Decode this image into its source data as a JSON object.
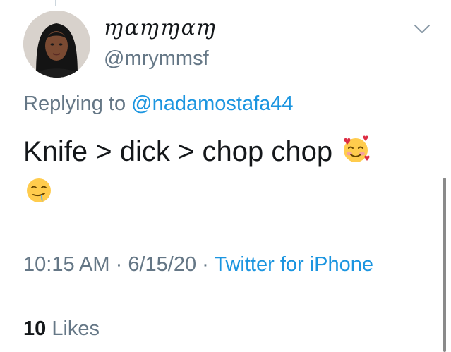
{
  "tweet": {
    "display_name": "ɱɑɱɱɑɱ",
    "handle": "@mrymmsf",
    "replying_prefix": "Replying to",
    "replying_to": "@nadamostafa44",
    "text": "Knife > dick > chop chop",
    "emojis": [
      "smiling-face-with-hearts",
      "drooling-face"
    ],
    "time": "10:15 AM",
    "separator": "·",
    "date": "6/15/20",
    "source": "Twitter for iPhone",
    "likes_count": "10",
    "likes_label": "Likes"
  },
  "colors": {
    "text_primary": "#14171a",
    "text_secondary": "#657786",
    "link": "#1b95e0",
    "divider": "#e1e8ed"
  },
  "icons": {
    "menu": "chevron-down-icon"
  }
}
